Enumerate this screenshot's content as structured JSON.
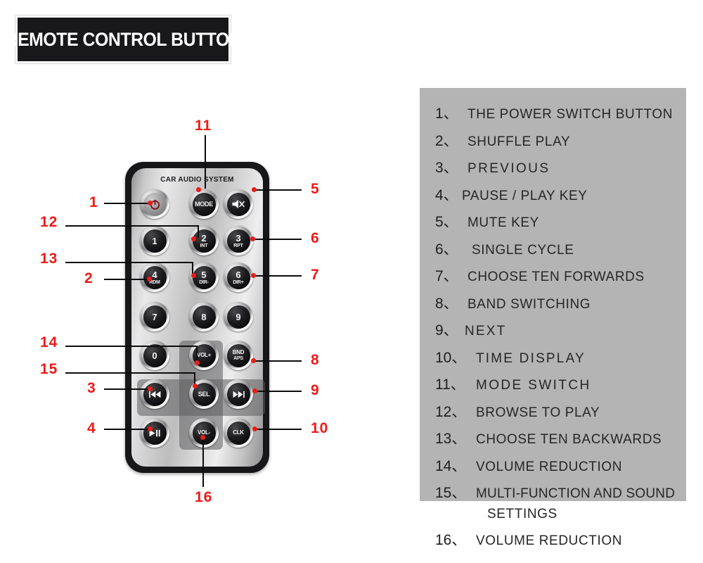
{
  "title": {
    "text": "REMOTE CONTROL BUTTON"
  },
  "remote": {
    "brand": "CAR AUDIO SYSTEM",
    "buttons": [
      {
        "id": "power",
        "main": "power-glyph",
        "sub": ""
      },
      {
        "id": "mode",
        "main": "MODE",
        "sub": ""
      },
      {
        "id": "mute",
        "main": "mute-glyph",
        "sub": ""
      },
      {
        "id": "key1",
        "main": "1",
        "sub": ""
      },
      {
        "id": "key2",
        "main": "2",
        "sub": "INT"
      },
      {
        "id": "key3",
        "main": "3",
        "sub": "RPT"
      },
      {
        "id": "key4",
        "main": "4",
        "sub": "RDM"
      },
      {
        "id": "key5",
        "main": "5",
        "sub": "DIR-"
      },
      {
        "id": "key6",
        "main": "6",
        "sub": "DIR+"
      },
      {
        "id": "key7",
        "main": "7",
        "sub": ""
      },
      {
        "id": "key8",
        "main": "8",
        "sub": ""
      },
      {
        "id": "key9",
        "main": "9",
        "sub": ""
      },
      {
        "id": "key0",
        "main": "0",
        "sub": ""
      },
      {
        "id": "volup",
        "main": "VOL+",
        "sub": ""
      },
      {
        "id": "band",
        "main": "BND",
        "sub": "APS"
      },
      {
        "id": "prev",
        "main": "prev-glyph",
        "sub": ""
      },
      {
        "id": "sel",
        "main": "SEL",
        "sub": ""
      },
      {
        "id": "next",
        "main": "next-glyph",
        "sub": ""
      },
      {
        "id": "play",
        "main": "play-pause-glyph",
        "sub": ""
      },
      {
        "id": "voldn",
        "main": "VOL-",
        "sub": ""
      },
      {
        "id": "clk",
        "main": "CLK",
        "sub": ""
      }
    ],
    "labels": {
      "mode": "MODE",
      "key1": "1",
      "key2": "2",
      "key2sub": "INT",
      "key3": "3",
      "key3sub": "RPT",
      "key4": "4",
      "key4sub": "RDM",
      "key5": "5",
      "key5sub": "DIR-",
      "key6": "6",
      "key6sub": "DIR+",
      "key7": "7",
      "key8": "8",
      "key9": "9",
      "key0": "0",
      "volup": "VOL+",
      "voldn": "VOL-",
      "band": "BND",
      "bandsub": "APS",
      "sel": "SEL",
      "clk": "CLK"
    },
    "callouts": [
      {
        "n": "1",
        "target": "power"
      },
      {
        "n": "2",
        "target": "key4-rdm"
      },
      {
        "n": "3",
        "target": "prev"
      },
      {
        "n": "4",
        "target": "play-pause"
      },
      {
        "n": "5",
        "target": "mute"
      },
      {
        "n": "6",
        "target": "key3-rpt"
      },
      {
        "n": "7",
        "target": "key6-dir-plus"
      },
      {
        "n": "8",
        "target": "band-aps"
      },
      {
        "n": "9",
        "target": "next"
      },
      {
        "n": "10",
        "target": "clk"
      },
      {
        "n": "11",
        "target": "mode"
      },
      {
        "n": "12",
        "target": "key2-int"
      },
      {
        "n": "13",
        "target": "key5-dir-minus"
      },
      {
        "n": "14",
        "target": "key0-vol-up"
      },
      {
        "n": "15",
        "target": "sel"
      },
      {
        "n": "16",
        "target": "vol-down"
      }
    ]
  },
  "legend": {
    "items": [
      {
        "index": "1、",
        "text": "THE POWER SWITCH BUTTON"
      },
      {
        "index": "2、",
        "text": "SHUFFLE PLAY"
      },
      {
        "index": "3、",
        "text": "PREVIOUS"
      },
      {
        "index": "4、",
        "text": "PAUSE / PLAY KEY"
      },
      {
        "index": "5、",
        "text": "MUTE KEY"
      },
      {
        "index": "6、",
        "text": "SINGLE CYCLE"
      },
      {
        "index": "7、",
        "text": "CHOOSE TEN FORWARDS"
      },
      {
        "index": "8、",
        "text": "BAND SWITCHING"
      },
      {
        "index": "9、",
        "text": "NEXT"
      },
      {
        "index": "10、",
        "text": "TIME DISPLAY"
      },
      {
        "index": "11、",
        "text": "MODE SWITCH"
      },
      {
        "index": "12、",
        "text": "BROWSE TO PLAY"
      },
      {
        "index": "13、",
        "text": "CHOOSE TEN BACKWARDS"
      },
      {
        "index": "14、",
        "text": "VOLUME REDUCTION"
      },
      {
        "index": "15、",
        "text": "MULTI-FUNCTION AND SOUND",
        "cont": "SETTINGS"
      },
      {
        "index": "16、",
        "text": "VOLUME REDUCTION"
      }
    ]
  },
  "colors": {
    "accent_red": "#ee1b17",
    "panel_gray": "#b4b4b4",
    "title_bg": "#18181a",
    "lead_black": "#0c0c0c"
  }
}
